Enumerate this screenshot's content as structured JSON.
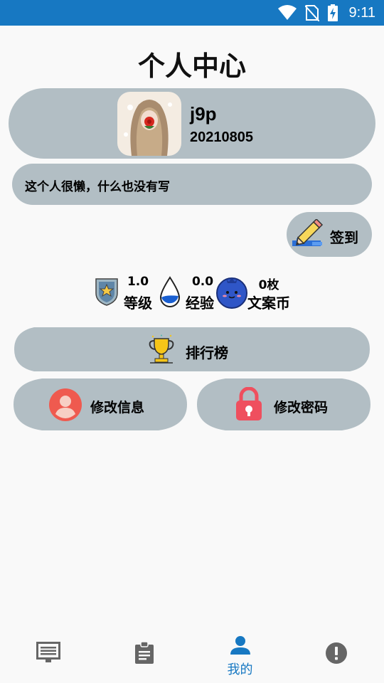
{
  "status_bar": {
    "time": "9:11",
    "color": "#1778c2"
  },
  "header": {
    "title": "个人中心"
  },
  "profile": {
    "username": "j9p",
    "user_id": "20210805",
    "bio": "这个人很懒，什么也没有写"
  },
  "signin": {
    "label": "签到"
  },
  "stats": [
    {
      "value": "1.0",
      "label": "等级",
      "icon": "shield-star-icon"
    },
    {
      "value": "0.0",
      "label": "经验",
      "icon": "water-drop-icon"
    },
    {
      "value": "0枚",
      "label": "文案币",
      "icon": "blueberry-coin-icon"
    }
  ],
  "ranking": {
    "label": "排行榜",
    "icon": "trophy-icon"
  },
  "actions": {
    "edit_info": "修改信息",
    "change_password": "修改密码"
  },
  "bottom_nav": {
    "items": [
      {
        "icon": "list-icon",
        "label": "",
        "active": false
      },
      {
        "icon": "clipboard-icon",
        "label": "",
        "active": false
      },
      {
        "icon": "person-icon",
        "label": "我的",
        "active": true
      },
      {
        "icon": "info-icon",
        "label": "",
        "active": false
      }
    ]
  },
  "colors": {
    "card": "#b2bec4",
    "accent": "#1778c2",
    "background": "#f9f9f9"
  }
}
